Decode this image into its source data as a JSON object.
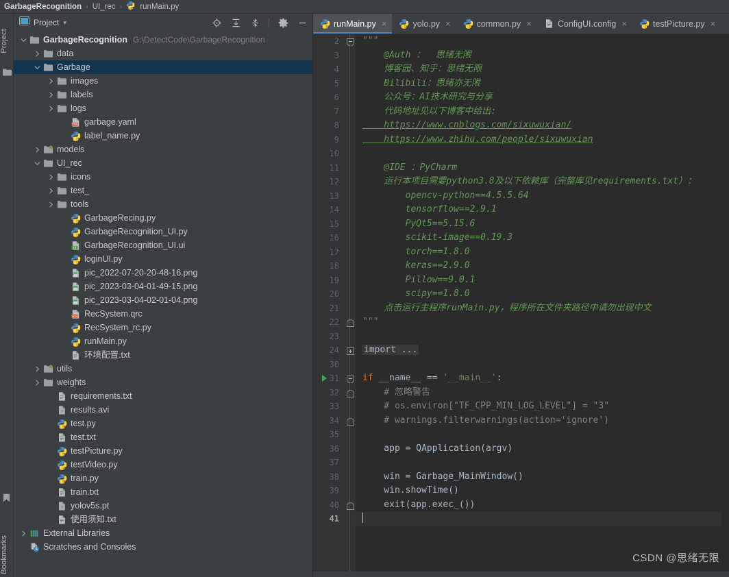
{
  "breadcrumb": {
    "project": "GarbageRecognition",
    "folder": "UI_rec",
    "file": "runMain.py",
    "sep": "›"
  },
  "toolstrip": {
    "top_label": "Project",
    "bottom_label": "Bookmarks"
  },
  "project_panel": {
    "title": "Project",
    "dropdown_caret": "▾",
    "buttons": [
      "locate-icon",
      "expand-all-icon",
      "collapse-all-icon",
      "settings-icon",
      "hide-icon"
    ]
  },
  "tree": [
    {
      "indent": 0,
      "arrow": "down",
      "icon": "folder",
      "label": "GarbageRecognition",
      "bold": true,
      "path": "G:\\DetectCode\\GarbageRecognition"
    },
    {
      "indent": 1,
      "arrow": "right",
      "icon": "folder",
      "label": "data"
    },
    {
      "indent": 1,
      "arrow": "down",
      "icon": "folder",
      "label": "Garbage",
      "selected": true
    },
    {
      "indent": 2,
      "arrow": "right",
      "icon": "folder",
      "label": "images"
    },
    {
      "indent": 2,
      "arrow": "right",
      "icon": "folder",
      "label": "labels"
    },
    {
      "indent": 2,
      "arrow": "right",
      "icon": "folder",
      "label": "logs"
    },
    {
      "indent": 3,
      "arrow": "none",
      "icon": "yaml",
      "label": "garbage.yaml"
    },
    {
      "indent": 3,
      "arrow": "none",
      "icon": "python",
      "label": "label_name.py"
    },
    {
      "indent": 1,
      "arrow": "right",
      "icon": "folder-src",
      "label": "models"
    },
    {
      "indent": 1,
      "arrow": "down",
      "icon": "folder",
      "label": "UI_rec"
    },
    {
      "indent": 2,
      "arrow": "right",
      "icon": "folder",
      "label": "icons"
    },
    {
      "indent": 2,
      "arrow": "right",
      "icon": "folder",
      "label": "test_"
    },
    {
      "indent": 2,
      "arrow": "right",
      "icon": "folder",
      "label": "tools"
    },
    {
      "indent": 3,
      "arrow": "none",
      "icon": "python",
      "label": "GarbageRecing.py"
    },
    {
      "indent": 3,
      "arrow": "none",
      "icon": "python",
      "label": "GarbageRecognition_UI.py"
    },
    {
      "indent": 3,
      "arrow": "none",
      "icon": "ui",
      "label": "GarbageRecognition_UI.ui"
    },
    {
      "indent": 3,
      "arrow": "none",
      "icon": "python",
      "label": "loginUI.py"
    },
    {
      "indent": 3,
      "arrow": "none",
      "icon": "image",
      "label": "pic_2022-07-20-20-48-16.png"
    },
    {
      "indent": 3,
      "arrow": "none",
      "icon": "image",
      "label": "pic_2023-03-04-01-49-15.png"
    },
    {
      "indent": 3,
      "arrow": "none",
      "icon": "image",
      "label": "pic_2023-03-04-02-01-04.png"
    },
    {
      "indent": 3,
      "arrow": "none",
      "icon": "qrc",
      "label": "RecSystem.qrc"
    },
    {
      "indent": 3,
      "arrow": "none",
      "icon": "python",
      "label": "RecSystem_rc.py"
    },
    {
      "indent": 3,
      "arrow": "none",
      "icon": "python",
      "label": "runMain.py"
    },
    {
      "indent": 3,
      "arrow": "none",
      "icon": "text",
      "label": "环境配置.txt"
    },
    {
      "indent": 1,
      "arrow": "right",
      "icon": "folder-src",
      "label": "utils"
    },
    {
      "indent": 1,
      "arrow": "right",
      "icon": "folder",
      "label": "weights"
    },
    {
      "indent": 2,
      "arrow": "none",
      "icon": "text",
      "label": "requirements.txt"
    },
    {
      "indent": 2,
      "arrow": "none",
      "icon": "unknown",
      "label": "results.avi"
    },
    {
      "indent": 2,
      "arrow": "none",
      "icon": "python",
      "label": "test.py"
    },
    {
      "indent": 2,
      "arrow": "none",
      "icon": "text",
      "label": "test.txt"
    },
    {
      "indent": 2,
      "arrow": "none",
      "icon": "python",
      "label": "testPicture.py"
    },
    {
      "indent": 2,
      "arrow": "none",
      "icon": "python",
      "label": "testVideo.py"
    },
    {
      "indent": 2,
      "arrow": "none",
      "icon": "python",
      "label": "train.py"
    },
    {
      "indent": 2,
      "arrow": "none",
      "icon": "text",
      "label": "train.txt"
    },
    {
      "indent": 2,
      "arrow": "none",
      "icon": "unknown",
      "label": "yolov5s.pt"
    },
    {
      "indent": 2,
      "arrow": "none",
      "icon": "text",
      "label": "使用须知.txt"
    },
    {
      "indent": 0,
      "arrow": "right",
      "icon": "library",
      "label": "External Libraries"
    },
    {
      "indent": 0,
      "arrow": "none",
      "icon": "scratch",
      "label": "Scratches and Consoles"
    }
  ],
  "tabs": [
    {
      "label": "runMain.py",
      "icon": "python",
      "active": true,
      "close": "×"
    },
    {
      "label": "yolo.py",
      "icon": "python",
      "active": false,
      "close": "×"
    },
    {
      "label": "common.py",
      "icon": "python",
      "active": false,
      "close": "×"
    },
    {
      "label": "ConfigUI.config",
      "icon": "text",
      "active": false,
      "close": "×"
    },
    {
      "label": "testPicture.py",
      "icon": "python",
      "active": false,
      "close": "×"
    }
  ],
  "editor": {
    "current_line": 41,
    "lines": [
      {
        "n": 2,
        "fold": "end-top",
        "segs": [
          {
            "t": "\"\"\"",
            "c": "doc"
          }
        ]
      },
      {
        "n": 3,
        "segs": [
          {
            "t": "    @Auth ：  思绪无限",
            "c": "doc"
          }
        ]
      },
      {
        "n": 4,
        "segs": [
          {
            "t": "    博客园、知乎：思绪无限",
            "c": "doc"
          }
        ]
      },
      {
        "n": 5,
        "segs": [
          {
            "t": "    Bilibili：思绪亦无限",
            "c": "doc"
          }
        ]
      },
      {
        "n": 6,
        "segs": [
          {
            "t": "    公众号：AI技术研究与分享",
            "c": "doc"
          }
        ]
      },
      {
        "n": 7,
        "segs": [
          {
            "t": "    代码地址见以下博客中给出:",
            "c": "doc"
          }
        ]
      },
      {
        "n": 8,
        "segs": [
          {
            "t": "    https://www.cnblogs.com/sixuwuxian/",
            "c": "lnk"
          }
        ]
      },
      {
        "n": 9,
        "segs": [
          {
            "t": "    https://www.zhihu.com/people/sixuwuxian",
            "c": "lnk"
          }
        ]
      },
      {
        "n": 10,
        "segs": []
      },
      {
        "n": 11,
        "segs": [
          {
            "t": "    @IDE ：PyCharm",
            "c": "doc"
          }
        ]
      },
      {
        "n": 12,
        "segs": [
          {
            "t": "    运行本项目需要python3.8及以下依赖库（完整库见requirements.txt）：",
            "c": "doc"
          }
        ]
      },
      {
        "n": 13,
        "segs": [
          {
            "t": "        opencv-python==4.5.5.64",
            "c": "doc"
          }
        ]
      },
      {
        "n": 14,
        "segs": [
          {
            "t": "        tensorflow==2.9.1",
            "c": "doc"
          }
        ]
      },
      {
        "n": 15,
        "segs": [
          {
            "t": "        PyQt5==5.15.6",
            "c": "doc"
          }
        ]
      },
      {
        "n": 16,
        "segs": [
          {
            "t": "        scikit-image==0.19.3",
            "c": "doc"
          }
        ]
      },
      {
        "n": 17,
        "segs": [
          {
            "t": "        torch==1.8.0",
            "c": "doc"
          }
        ]
      },
      {
        "n": 18,
        "segs": [
          {
            "t": "        keras==2.9.0",
            "c": "doc"
          }
        ]
      },
      {
        "n": 19,
        "segs": [
          {
            "t": "        Pillow==9.0.1",
            "c": "doc"
          }
        ]
      },
      {
        "n": 20,
        "segs": [
          {
            "t": "        scipy==1.8.0",
            "c": "doc"
          }
        ]
      },
      {
        "n": 21,
        "segs": [
          {
            "t": "    点击运行主程序runMain.py，程序所在文件夹路径中请勿出现中文",
            "c": "doc"
          }
        ]
      },
      {
        "n": 22,
        "fold": "end-bot",
        "segs": [
          {
            "t": "\"\"\"",
            "c": "doc"
          }
        ]
      },
      {
        "n": 23,
        "segs": []
      },
      {
        "n": 24,
        "fold": "plus",
        "segs": [
          {
            "t": "import ...",
            "c": "fold-lbl"
          }
        ]
      },
      {
        "n": 30,
        "segs": []
      },
      {
        "n": 31,
        "fold": "minus",
        "run": true,
        "segs": [
          {
            "t": "if",
            "c": "kw"
          },
          {
            "t": " __name__ == ",
            "c": "plain"
          },
          {
            "t": "'__main__'",
            "c": "str"
          },
          {
            "t": ":",
            "c": "plain"
          }
        ]
      },
      {
        "n": 32,
        "fold": "end-bot2",
        "segs": [
          {
            "t": "    # 忽略警告",
            "c": "cmt"
          }
        ]
      },
      {
        "n": 33,
        "segs": [
          {
            "t": "    # os.environ[\"TF_CPP_MIN_LOG_LEVEL\"] = \"3\"",
            "c": "cmt"
          }
        ]
      },
      {
        "n": 34,
        "fold": "end-bot3",
        "segs": [
          {
            "t": "    # warnings.filterwarnings(action='ignore')",
            "c": "cmt"
          }
        ]
      },
      {
        "n": 35,
        "segs": []
      },
      {
        "n": 36,
        "segs": [
          {
            "t": "    app = QApplication(argv)",
            "c": "plain"
          }
        ]
      },
      {
        "n": 37,
        "segs": []
      },
      {
        "n": 38,
        "segs": [
          {
            "t": "    win = Garbage_MainWindow()",
            "c": "plain"
          }
        ]
      },
      {
        "n": 39,
        "segs": [
          {
            "t": "    win.showTime()",
            "c": "plain"
          }
        ]
      },
      {
        "n": 40,
        "fold": "end-bot4",
        "segs": [
          {
            "t": "    exit(app.exec_())",
            "c": "plain"
          }
        ]
      },
      {
        "n": 41,
        "cursor": true,
        "segs": []
      }
    ]
  },
  "watermark": "CSDN @思绪无限",
  "colors": {
    "panel_bg": "#3c3f41",
    "editor_bg": "#2b2b2b",
    "gutter_bg": "#313335",
    "selection": "#13344f",
    "tab_active": "#4e5254",
    "tab_underline": "#4a88c7",
    "docstring": "#629755",
    "keyword": "#cc7832",
    "string": "#6a8759",
    "comment": "#808080",
    "code_text": "#a9b7c6",
    "run_green": "#499c54"
  }
}
